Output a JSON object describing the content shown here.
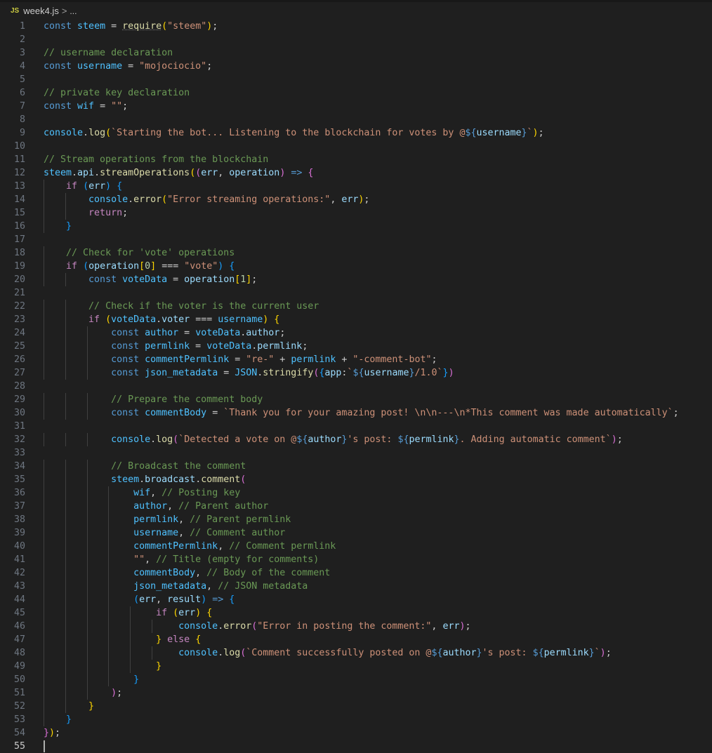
{
  "breadcrumb": {
    "file_icon": "JS",
    "file_name": "week4.js",
    "separator": ">",
    "more": "..."
  },
  "editor": {
    "language": "javascript",
    "active_line": 55,
    "lines": [
      {
        "n": 1,
        "text": "const steem = require(\"steem\");"
      },
      {
        "n": 2,
        "text": ""
      },
      {
        "n": 3,
        "text": "// username declaration"
      },
      {
        "n": 4,
        "text": "const username = \"mojociocio\";"
      },
      {
        "n": 5,
        "text": ""
      },
      {
        "n": 6,
        "text": "// private key declaration"
      },
      {
        "n": 7,
        "text": "const wif = \"\";"
      },
      {
        "n": 8,
        "text": ""
      },
      {
        "n": 9,
        "text": "console.log(`Starting the bot... Listening to the blockchain for votes by @${username}`);"
      },
      {
        "n": 10,
        "text": ""
      },
      {
        "n": 11,
        "text": "// Stream operations from the blockchain"
      },
      {
        "n": 12,
        "text": "steem.api.streamOperations((err, operation) => {"
      },
      {
        "n": 13,
        "text": "    if (err) {"
      },
      {
        "n": 14,
        "text": "        console.error(\"Error streaming operations:\", err);"
      },
      {
        "n": 15,
        "text": "        return;"
      },
      {
        "n": 16,
        "text": "    }"
      },
      {
        "n": 17,
        "text": ""
      },
      {
        "n": 18,
        "text": "    // Check for 'vote' operations"
      },
      {
        "n": 19,
        "text": "    if (operation[0] === \"vote\") {"
      },
      {
        "n": 20,
        "text": "        const voteData = operation[1];"
      },
      {
        "n": 21,
        "text": ""
      },
      {
        "n": 22,
        "text": "        // Check if the voter is the current user"
      },
      {
        "n": 23,
        "text": "        if (voteData.voter === username) {"
      },
      {
        "n": 24,
        "text": "            const author = voteData.author;"
      },
      {
        "n": 25,
        "text": "            const permlink = voteData.permlink;"
      },
      {
        "n": 26,
        "text": "            const commentPermlink = \"re-\" + permlink + \"-comment-bot\";"
      },
      {
        "n": 27,
        "text": "            const json_metadata = JSON.stringify({app:`${username}/1.0`})"
      },
      {
        "n": 28,
        "text": ""
      },
      {
        "n": 29,
        "text": "            // Prepare the comment body"
      },
      {
        "n": 30,
        "text": "            const commentBody = `Thank you for your amazing post! \\n\\n---\\n*This comment was made automatically`;"
      },
      {
        "n": 31,
        "text": ""
      },
      {
        "n": 32,
        "text": "            console.log(`Detected a vote on @${author}'s post: ${permlink}. Adding automatic comment`);"
      },
      {
        "n": 33,
        "text": ""
      },
      {
        "n": 34,
        "text": "            // Broadcast the comment"
      },
      {
        "n": 35,
        "text": "            steem.broadcast.comment("
      },
      {
        "n": 36,
        "text": "                wif, // Posting key"
      },
      {
        "n": 37,
        "text": "                author, // Parent author"
      },
      {
        "n": 38,
        "text": "                permlink, // Parent permlink"
      },
      {
        "n": 39,
        "text": "                username, // Comment author"
      },
      {
        "n": 40,
        "text": "                commentPermlink, // Comment permlink"
      },
      {
        "n": 41,
        "text": "                \"\", // Title (empty for comments)"
      },
      {
        "n": 42,
        "text": "                commentBody, // Body of the comment"
      },
      {
        "n": 43,
        "text": "                json_metadata, // JSON metadata"
      },
      {
        "n": 44,
        "text": "                (err, result) => {"
      },
      {
        "n": 45,
        "text": "                    if (err) {"
      },
      {
        "n": 46,
        "text": "                        console.error(\"Error in posting the comment:\", err);"
      },
      {
        "n": 47,
        "text": "                    } else {"
      },
      {
        "n": 48,
        "text": "                        console.log(`Comment successfully posted on @${author}'s post: ${permlink}`);"
      },
      {
        "n": 49,
        "text": "                    }"
      },
      {
        "n": 50,
        "text": "                }"
      },
      {
        "n": 51,
        "text": "            );"
      },
      {
        "n": 52,
        "text": "        }"
      },
      {
        "n": 53,
        "text": "    }"
      },
      {
        "n": 54,
        "text": "});"
      },
      {
        "n": 55,
        "text": ""
      }
    ]
  },
  "colors": {
    "background": "#1f1f1f",
    "keyword": "#569cd6",
    "control": "#c586c0",
    "variable": "#9cdcfe",
    "function": "#dcdcaa",
    "string": "#ce9178",
    "comment": "#6a9955",
    "number": "#b5cea8"
  }
}
